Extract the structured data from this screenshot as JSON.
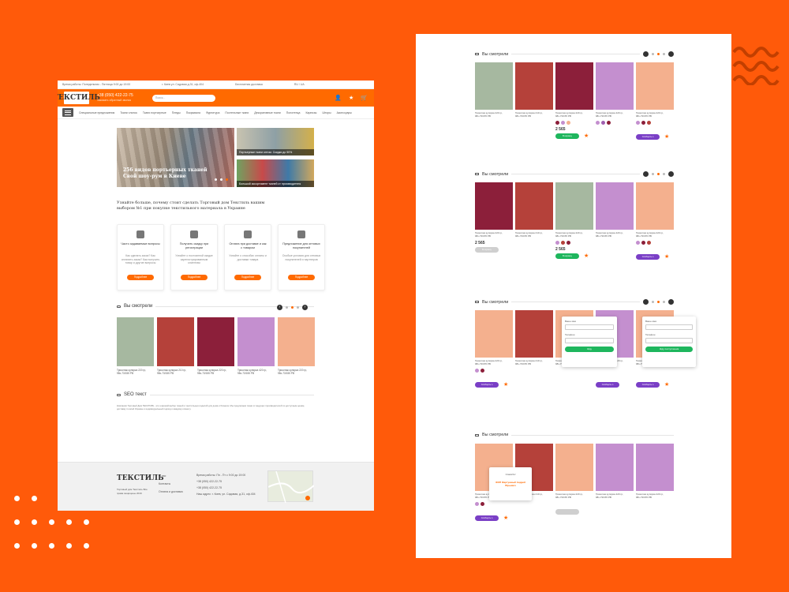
{
  "colors": {
    "accent": "#ff6a00",
    "background": "#ff5a0a",
    "green": "#1eb65d",
    "purple": "#7a3fc6"
  },
  "left_page": {
    "topbar": {
      "hours": "Время работы: Понедельник - Пятница 9:00 до 19:00",
      "address": "г. Киев ул. Садовая д.31, оф.404",
      "delivery": "Бесплатная доставка",
      "lang": "RU / UA"
    },
    "header": {
      "logo": "ТЕКСТИЛЬ",
      "phone": "+38 (050) 422-22-75",
      "phone_sub": "Заказать обратный звонок",
      "search_placeholder": "Поиск..."
    },
    "nav": [
      "Специальные предложения",
      "Ткани хлопок",
      "Ткани портьерные",
      "Пледы",
      "Покрывала",
      "Фурнитура",
      "Постельные ткани",
      "Декоративные ткани",
      "Полотенца",
      "Карнизы",
      "Шторы",
      "Аксессуары"
    ],
    "banner": {
      "title": "256 видов портьерных тканей",
      "subtitle": "Свой шоу-рум в Киеве",
      "side1": "Портьерные ткани оптом. Скидки до 50%",
      "side2": "Большой ассортимент тканей от производителя"
    },
    "why_title": "Узнайте больше, почему стоит сделать Торговый дом Текстиль вашим выбором №1 при покупке текстильного материала в Украине",
    "cards": [
      {
        "title": "Часто задаваемые вопросы",
        "desc": "Как сделать заказ? Как оплатить заказ? Как получить товар и другие вопросы",
        "btn": "Подробнее"
      },
      {
        "title": "Получить скидку при регистрации",
        "desc": "Узнайте о постоянной скидке зарегистрированным клиентам",
        "btn": "Подробнее"
      },
      {
        "title": "Оплата при доставке и как с товаром",
        "desc": "Узнайте о способах оплаты и доставки товара",
        "btn": "Подробнее"
      },
      {
        "title": "Предложение для оптовых покупателей",
        "desc": "Особые условия для оптовых покупателей и партнеров",
        "btn": "Подробнее"
      }
    ],
    "recent_title": "Вы смотрели",
    "products": [
      {
        "name": "Трикотаж кулирка 220 гр, 98х-73/155 РВ",
        "color": "#a6b8a0"
      },
      {
        "name": "Трикотаж кулирка 210 гр, 98х-73/155 РВ",
        "color": "#b5413a"
      },
      {
        "name": "Трикотаж кулирка 220 гр, 98х-73/155 РВ",
        "color": "#8c1f3a"
      },
      {
        "name": "Трикотаж кулирка 420 гр, 98х-73/155 РВ",
        "color": "#c48fcf"
      },
      {
        "name": "Трикотаж кулирка 220 гр, 98х-73/155 РВ",
        "color": "#f4b08e"
      }
    ],
    "seo_title": "SEO текст",
    "seo_text": "Компания Торговый Дом ТЕКСТИЛЬ - это широкий выбор тканей и текстильных изделий для дома и бизнеса. Мы предлагаем ткани от ведущих производителей по доступным ценам, доставку по всей Украине и индивидуальный подход к каждому клиенту.",
    "footer": {
      "logo": "ТЕКСТИЛЬ",
      "copy": "Торговый дом Текстиль Все права защищены 2019",
      "links": [
        "О нас",
        "Контакты",
        "Оплата и доставка"
      ],
      "schedule": "Время работы: Пн - Пт с 9:00 до 19:00",
      "phone1": "+38 (050) 422-22-75",
      "phone2": "+38 (050) 422-22-75",
      "phone3": "+38 (050) 422-22-75",
      "address": "Наш адрес: г. Киев, ул. Садовая, д.31, оф.404"
    }
  },
  "right_panel": {
    "section_title": "Вы смотрели",
    "sections": [
      {
        "products": [
          {
            "name": "Трикотаж кулирка 220 гр, 98х-73/155 РВ",
            "color": "#a6b8a0"
          },
          {
            "name": "Трикотаж кулирка 210 гр, 98х-73/155 РВ",
            "color": "#b5413a"
          },
          {
            "name": "Трикотаж кулирка 220 гр, 98х-73/155 РВ",
            "color": "#8c1f3a",
            "price": "2 565",
            "btn": "В корзину"
          },
          {
            "name": "Трикотаж кулирка 420 гр, 98х-73/155 РВ",
            "color": "#c48fcf"
          },
          {
            "name": "Трикотаж кулирка 220 гр, 98х-73/155 РВ",
            "color": "#f4b08e",
            "btn": "Сообщить о поступлении"
          }
        ]
      },
      {
        "products": [
          {
            "name": "Трикотаж кулирка 220 гр, 98х-73/155 РВ",
            "color": "#8c1f3a",
            "price": "2 565",
            "btn": "В корзину"
          },
          {
            "name": "Трикотаж кулирка 210 гр, 98х-73/155 РВ",
            "color": "#b5413a"
          },
          {
            "name": "Трикотаж кулирка 220 гр, 98х-73/155 РВ",
            "color": "#a6b8a0",
            "price": "2 565",
            "btn": "В корзину"
          },
          {
            "name": "Трикотаж кулирка 420 гр, 98х-73/155 РВ",
            "color": "#c48fcf"
          },
          {
            "name": "Трикотаж кулирка 220 гр, 98х-73/155 РВ",
            "color": "#f4b08e",
            "btn": "Сообщить о поступлении"
          }
        ]
      },
      {
        "products": [
          {
            "name": "Трикотаж кулирка 220 гр, 98х-73/155 РВ",
            "color": "#f4b08e",
            "btn": "Сообщить о поступлении"
          },
          {
            "name": "Трикотаж кулирка 210 гр, 98х-73/155 РВ",
            "color": "#b5413a"
          },
          {
            "name": "Трикотаж кулирка 220 гр, 98х-73/155 РВ",
            "color": "#f4b08e"
          },
          {
            "name": "Трикотаж кулирка 420 гр, 98х-73/155 РВ",
            "color": "#c48fcf",
            "btn": "Сообщить о поступлении"
          },
          {
            "name": "Трикотаж кулирка 220 гр, 98х-73/155 РВ",
            "color": "#f4b08e",
            "btn": "Сообщить о поступлении"
          }
        ],
        "popup": {
          "name_label": "Ваше имя",
          "phone_label": "Телефон",
          "submit": "Жду",
          "alt_submit": "Жду поступления"
        }
      },
      {
        "products": [
          {
            "name": "Трикотаж кулирка 220 гр, 98х-73/155 РВ",
            "color": "#f4b08e",
            "btn": "Сообщить о поступлении"
          },
          {
            "name": "Трикотаж кулирка 210 гр, 98х-73/155 РВ",
            "color": "#b5413a"
          },
          {
            "name": "Трикотаж кулирка 220 гр, 98х-73/155 РВ",
            "color": "#f4b08e"
          },
          {
            "name": "Трикотаж кулирка 420 гр, 98х-73/155 РВ",
            "color": "#c48fcf"
          },
          {
            "name": "Трикотаж кулирка 220 гр, 98х-73/155 РВ",
            "color": "#c48fcf"
          }
        ],
        "thanks": {
          "title": "Спасибо!",
          "line": "ФОП Фартушный Андрей Юрьевич"
        }
      }
    ]
  }
}
